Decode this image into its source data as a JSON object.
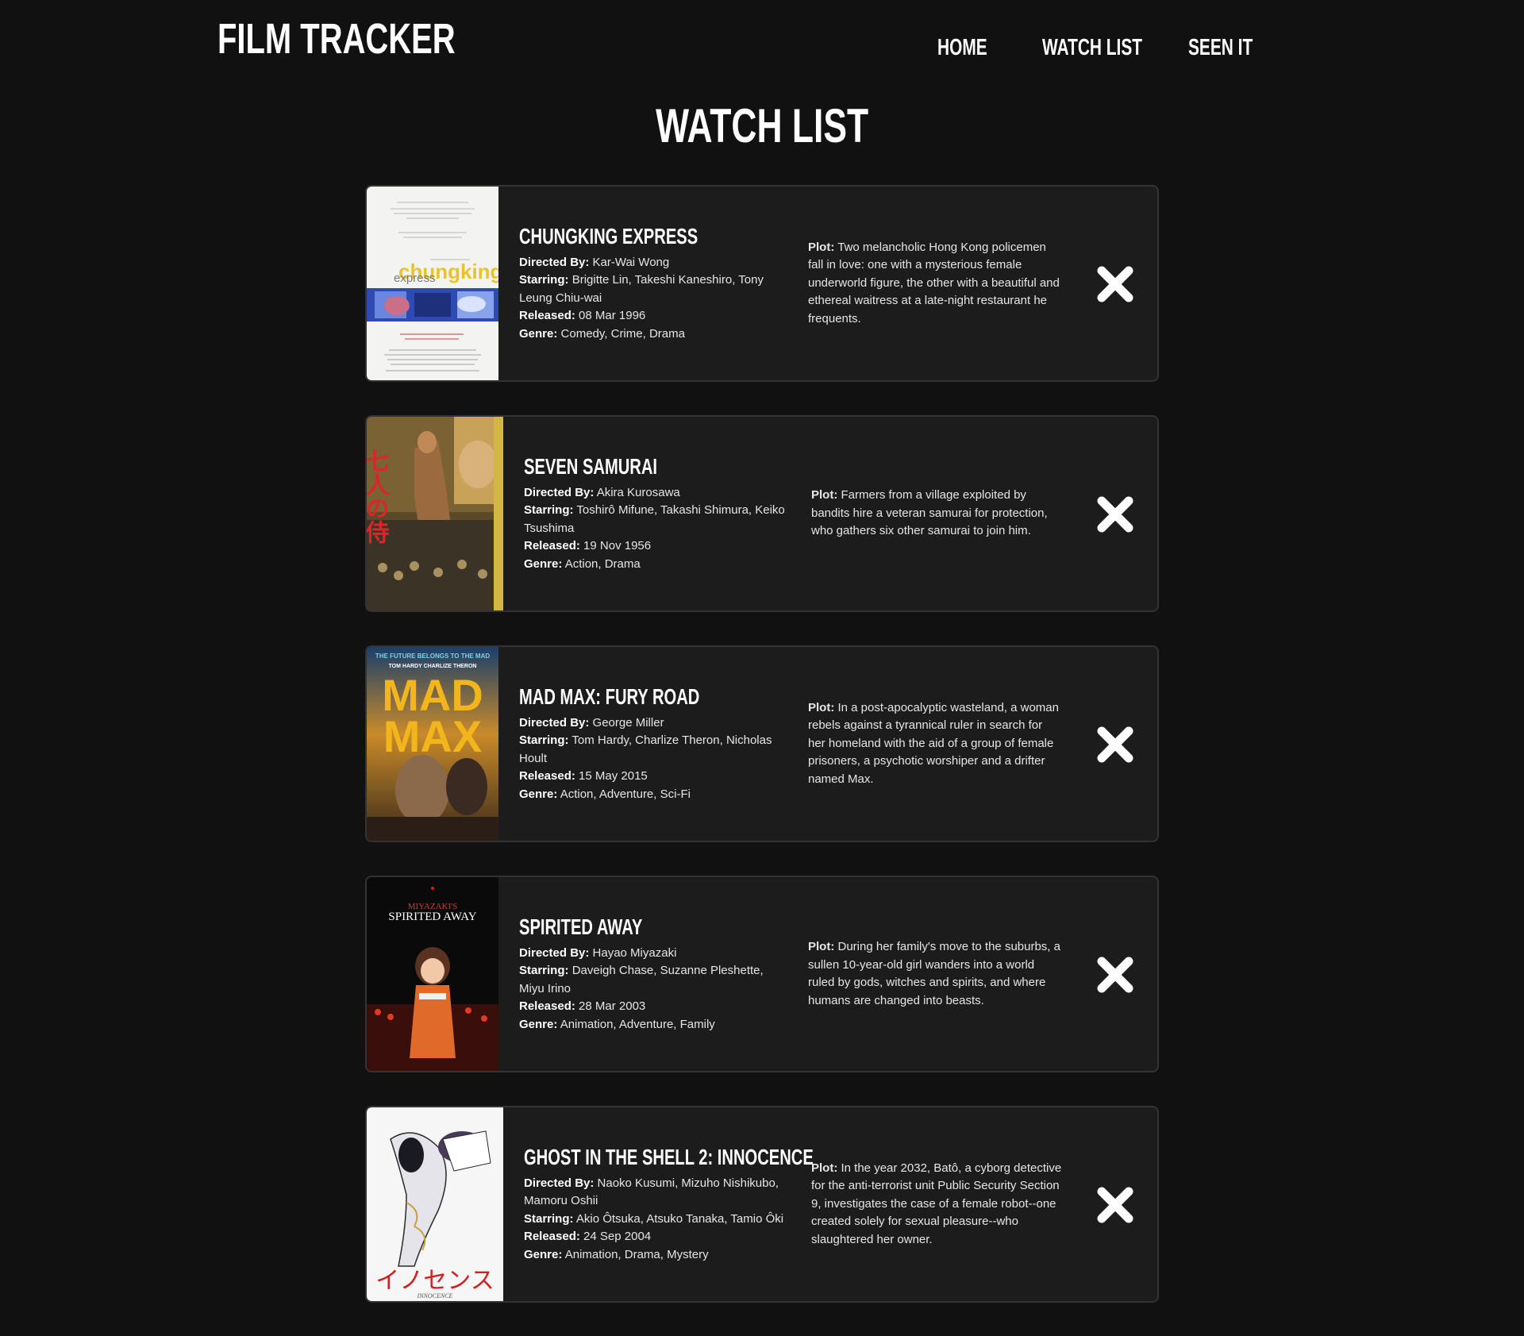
{
  "app": {
    "brand": "FILM TRACKER"
  },
  "nav": {
    "home": "HOME",
    "watch_list": "WATCH LIST",
    "seen_it": "SEEN IT"
  },
  "page": {
    "title": "WATCH LIST"
  },
  "labels": {
    "directed_by": "Directed By:",
    "starring": "Starring:",
    "released": "Released:",
    "genre": "Genre:",
    "plot": "Plot:"
  },
  "colors": {
    "background": "#111111",
    "card": "#1c1c1c",
    "card_border": "#333333",
    "text": "#ffffff"
  },
  "icons": {
    "remove": "close-x-icon"
  },
  "movies": [
    {
      "title": "CHUNGKING EXPRESS",
      "directed_by": "Kar-Wai Wong",
      "starring": "Brigitte Lin, Takeshi Kaneshiro, Tony Leung Chiu-wai",
      "released": "08 Mar 1996",
      "genre": "Comedy, Crime, Drama",
      "plot": "Two melancholic Hong Kong policemen fall in love: one with a mysterious female underworld figure, the other with a beautiful and ethereal waitress at a late-night restaurant he frequents.",
      "poster_text": "chungking",
      "poster_subtext": "express"
    },
    {
      "title": "SEVEN SAMURAI",
      "directed_by": "Akira Kurosawa",
      "starring": "Toshirô Mifune, Takashi Shimura, Keiko Tsushima",
      "released": "19 Nov 1956",
      "genre": "Action, Drama",
      "plot": "Farmers from a village exploited by bandits hire a veteran samurai for protection, who gathers six other samurai to join him.",
      "poster_text": "七人の侍"
    },
    {
      "title": "MAD MAX: FURY ROAD",
      "directed_by": "George Miller",
      "starring": "Tom Hardy, Charlize Theron, Nicholas Hoult",
      "released": "15 May 2015",
      "genre": "Action, Adventure, Sci-Fi",
      "plot": "In a post-apocalyptic wasteland, a woman rebels against a tyrannical ruler in search for her homeland with the aid of a group of female prisoners, a psychotic worshiper and a drifter named Max.",
      "poster_tagline": "THE FUTURE BELONGS TO THE MAD",
      "poster_actors": "TOM HARDY    CHARLIZE THERON",
      "poster_line1": "MAD",
      "poster_line2": "MAX"
    },
    {
      "title": "SPIRITED AWAY",
      "directed_by": "Hayao Miyazaki",
      "starring": "Daveigh Chase, Suzanne Pleshette, Miyu Irino",
      "released": "28 Mar 2003",
      "genre": "Animation, Adventure, Family",
      "plot": "During her family's move to the suburbs, a sullen 10-year-old girl wanders into a world ruled by gods, witches and spirits, and where humans are changed into beasts.",
      "poster_top": "MIYAZAKI'S",
      "poster_text": "SPIRITED AWAY"
    },
    {
      "title": "GHOST IN THE SHELL 2: INNOCENCE",
      "directed_by": "Naoko Kusumi, Mizuho Nishikubo, Mamoru Oshii",
      "starring": "Akio Ôtsuka, Atsuko Tanaka, Tamio Ôki",
      "released": "24 Sep 2004",
      "genre": "Animation, Drama, Mystery",
      "plot": "In the year 2032, Batô, a cyborg detective for the anti-terrorist unit Public Security Section 9, investigates the case of a female robot--one created solely for sexual pleasure--who slaughtered her owner.",
      "poster_text": "イノセンス",
      "poster_subtext": "INNOCENCE"
    }
  ]
}
